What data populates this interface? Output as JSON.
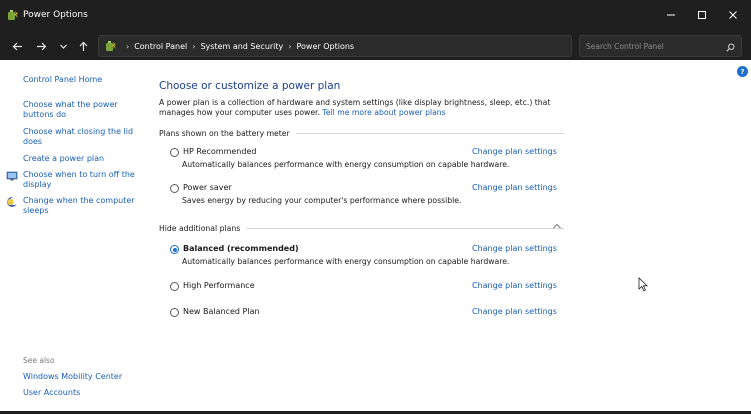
{
  "window": {
    "title": "Power Options",
    "controls": {
      "minimize": "minimize-icon",
      "maximize": "maximize-icon",
      "close": "close-icon"
    }
  },
  "addressbar": {
    "breadcrumbs": [
      "Control Panel",
      "System and Security",
      "Power Options"
    ],
    "search_placeholder": "Search Control Panel",
    "search_value": ""
  },
  "sidebar": {
    "home": "Control Panel Home",
    "links": [
      {
        "label": "Choose what the power buttons do",
        "icon": null
      },
      {
        "label": "Choose what closing the lid does",
        "icon": null
      },
      {
        "label": "Create a power plan",
        "icon": null
      },
      {
        "label": "Choose when to turn off the display",
        "icon": "monitor-icon"
      },
      {
        "label": "Change when the computer sleeps",
        "icon": "moon-icon"
      }
    ],
    "see_also": "See also",
    "see_also_links": [
      "Windows Mobility Center",
      "User Accounts"
    ]
  },
  "main": {
    "title": "Choose or customize a power plan",
    "intro": "A power plan is a collection of hardware and system settings (like display brightness, sleep, etc.) that manages how your computer uses power.",
    "intro_link": "Tell me more about power plans",
    "battery_section": "Plans shown on the battery meter",
    "additional_section": "Hide additional plans",
    "change_link": "Change plan settings",
    "plans": [
      {
        "name": "HP Recommended",
        "description": "Automatically balances performance with energy consumption on capable hardware.",
        "selected": false
      },
      {
        "name": "Power saver",
        "description": "Saves energy by reducing your computer's performance where possible.",
        "selected": false
      },
      {
        "name": "Balanced (recommended)",
        "description": "Automatically balances performance with energy consumption on capable hardware.",
        "selected": true
      },
      {
        "name": "High Performance",
        "description": "",
        "selected": false
      },
      {
        "name": "New Balanced Plan",
        "description": "",
        "selected": false
      }
    ]
  },
  "colors": {
    "titlebar": "#1f1f1f",
    "link": "#1a5fb4",
    "heading": "#1c3f8c",
    "accent": "#1e6fd1"
  }
}
